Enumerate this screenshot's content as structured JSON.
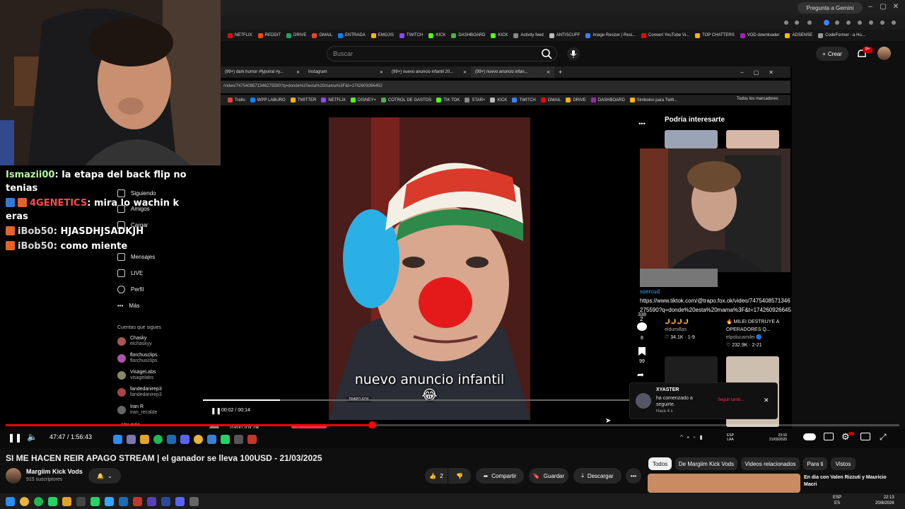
{
  "outer_browser": {
    "gemini_label": "Pregunta a Gemini",
    "bookmarks": [
      "NETFLIX",
      "REDDIT",
      "DRIVE",
      "GMAIL",
      "ENTRADA",
      "EMOJIS",
      "TWITCH",
      "KICK",
      "DASHBOARD",
      "KICK",
      "Activity feed",
      "ANTISCUFF",
      "Image Resizer | Resi...",
      "Convert YouTube Vi...",
      "TOP CHATTERS",
      "VOD downloader",
      "ADSENSE",
      "CodeFormer - a Hu..."
    ]
  },
  "yt_header": {
    "search_placeholder": "Buscar",
    "create_label": "Crear",
    "notif_count": "9+"
  },
  "inner_browser": {
    "tabs": [
      "(99+) dark humor #fypviral #y...",
      "Instagram",
      "(99+) nuevo anuncio infantil 20...",
      "(99+) nuevo anuncio infan..."
    ],
    "address": "/video/7475408571346275590?q=donde%20esta%20mama%3F&t=1742609266452",
    "bookmarks": [
      "Trello",
      "WPP LABURO",
      "TWITTER",
      "NETFLIX",
      "DISNEY+",
      "COTROL DE GASTOS",
      "TIK TOK",
      "STAR+",
      "KICK",
      "TWITCH",
      "GMAIL",
      "DRIVE",
      "DASHBOARD",
      "Simbolos para Twitt..."
    ],
    "all_bookmarks": "Todos los marcadores"
  },
  "chat": [
    {
      "user": "Ismazii00",
      "text": "la etapa del back flip no tenias",
      "color": "#b8f5a0",
      "badges": []
    },
    {
      "user": "4GENETICS",
      "text": "mira lo wachin k eras",
      "color": "#ff4b4b",
      "badges": [
        "#2e7cd6",
        "#e5632b"
      ]
    },
    {
      "user": "iBob50",
      "text": "HJASDHJSADKJH",
      "color": "#d7d7d7",
      "badges": [
        "#e5632b"
      ]
    },
    {
      "user": "iBob50",
      "text": "como miente",
      "color": "#d7d7d7",
      "badges": [
        "#e5632b"
      ]
    }
  ],
  "tiktok": {
    "nav": [
      "Siguiendo",
      "Amigos",
      "Cargar",
      "Mensajes",
      "LIVE",
      "Perfil",
      "Más"
    ],
    "following_title": "Cuentas que sigues",
    "following": [
      {
        "name": "Chasky",
        "handle": "elchaskyy"
      },
      {
        "name": "florchusclips",
        "handle": "florchusclips"
      },
      {
        "name": "VisageLabs",
        "handle": "visagelabs"
      },
      {
        "name": "fandedanirep3",
        "handle": "fandedanirep3"
      },
      {
        "name": "Iran R",
        "handle": "iran_recalde"
      }
    ],
    "see_more": "Ver más",
    "caption": "nuevo anuncio infantil",
    "caption_emoji": "😂",
    "watermark": "TRAPO FOX",
    "elapsed": "00:02",
    "duration": "00:14",
    "progress": 0.18,
    "side_counts": [
      "338",
      "8",
      "99"
    ],
    "suggest_title": "Podría interesarte",
    "overlay_link": "https://www.tiktok.com/@trapo.fox.ok/video/7475408571346275590?q=donde%20esta%20mama%3F&t=1742609266452",
    "overlay_prefix": "ssercud",
    "suggestions": [
      {
        "title": "🤳🤳🤳🤳",
        "author": "eldumillas",
        "stats": "♡ 34.1K · 1-9"
      },
      {
        "title": "🔥 MILEI DESTRUYE A OPERADORES Q...",
        "author": "elpolucamilei 🔵",
        "stats": "♡ 232.9K · 2-21"
      }
    ],
    "author_bar": "trapo.fox.ok",
    "notification": {
      "user": "XYASTER",
      "text": "ha comenzado a seguirte.",
      "time": "Hace 4 s",
      "action": "Seguir tamb..."
    }
  },
  "player": {
    "time": "47:47 / 1:56:43",
    "progress": 0.41,
    "tb_lang": "ESP\nLAA",
    "tb_clock": "23:16\n21/03/2025"
  },
  "video": {
    "title": "SI ME HACEN REIR APAGO STREAM | el ganador se lleva 100USD - 21/03/2025",
    "channel": "Margiim Kick Vods",
    "subs": "915 suscriptores",
    "likes": "2",
    "share": "Compartir",
    "save": "Guardar",
    "download": "Descargar"
  },
  "chips": [
    "Todos",
    "De Margiim Kick Vods",
    "Videos relacionados",
    "Para ti",
    "Vistos"
  ],
  "related": {
    "title": "En dia con Valen Rizzuti y Mauricio Macri"
  },
  "taskbar": {
    "lang": "ESP\nES",
    "clock": "22:13\n20/8/2026"
  },
  "colors": {
    "yt_red": "#ff0000",
    "accent": "#3ea6ff",
    "tiktok_red": "#fe2c55"
  }
}
